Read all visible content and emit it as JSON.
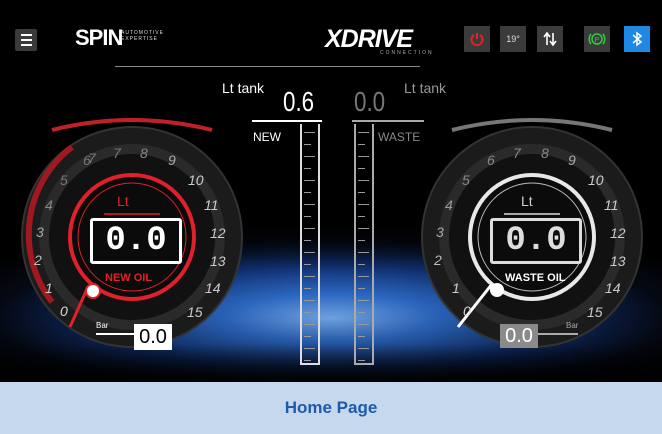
{
  "header": {
    "menu_icon": "hamburger-menu-icon",
    "brand": {
      "name": "SPIN",
      "tagline": "AUTOMOTIVE EXPERTISE"
    },
    "app_logo": {
      "name": "XDRIVE",
      "tagline": "CONNECTION"
    },
    "status": {
      "power_icon": "power-icon",
      "temperature": "19°",
      "transfer_icon": "transfer-arrows-icon",
      "brake_icon": "brake-warning-icon",
      "bluetooth_icon": "bluetooth-icon"
    },
    "colors": {
      "power": "#e02424",
      "brake": "#2ecc40",
      "bluetooth": "#1e88e5"
    }
  },
  "new_oil": {
    "unit": "Lt",
    "value": "0.0",
    "label": "NEW OIL",
    "dial_numbers": [
      "0",
      "1",
      "2",
      "3",
      "4",
      "5",
      "6",
      "7",
      "8",
      "9",
      "10",
      "11",
      "12",
      "13",
      "14",
      "15"
    ],
    "pressure_unit": "Bar",
    "pressure_value": "0.0",
    "accent": "#e0202a"
  },
  "waste_oil": {
    "unit": "Lt",
    "value": "0.0",
    "label": "WASTE OIL",
    "dial_numbers": [
      "0",
      "1",
      "2",
      "3",
      "4",
      "5",
      "6",
      "7",
      "8",
      "9",
      "10",
      "11",
      "12",
      "13",
      "14",
      "15"
    ],
    "pressure_unit": "Bar",
    "pressure_value": "0.0",
    "accent": "#e8e8e8"
  },
  "tanks": {
    "new": {
      "unit_label": "Lt tank",
      "value": "0.6",
      "name": "NEW"
    },
    "waste": {
      "unit_label": "Lt tank",
      "value": "0.0",
      "name": "WASTE"
    }
  },
  "footer": {
    "caption": "Home Page"
  }
}
